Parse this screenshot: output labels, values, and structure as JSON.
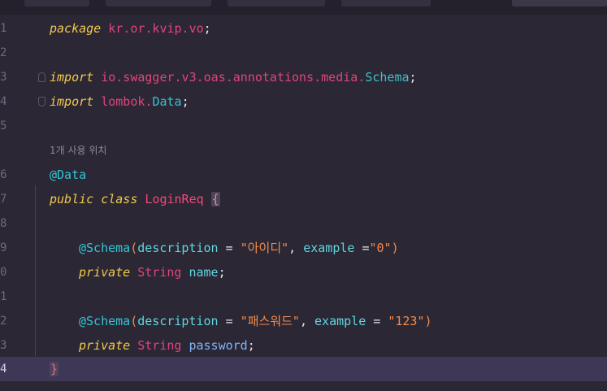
{
  "editor": {
    "line_numbers": [
      "1",
      "2",
      "3",
      "4",
      "5",
      "",
      "6",
      "7",
      "8",
      "9",
      "0",
      "1",
      "2",
      "3",
      "4"
    ],
    "inlay_hint": "1개 사용 위치",
    "tokens": {
      "l1_kw": "package",
      "l1_pkg": "kr.or.kvip.vo",
      "l1_end": ";",
      "l3_kw": "import",
      "l3_pkg": "io.swagger.v3.oas.annotations.media.",
      "l3_cls": "Schema",
      "l3_end": ";",
      "l4_kw": "import",
      "l4_pkg": "lombok.",
      "l4_cls": "Data",
      "l4_end": ";",
      "l6_ann": "@Data",
      "l7_kw": "public class",
      "l7_name": "LoginReq",
      "l7_brace": "{",
      "l9_ann": "@Schema",
      "l9_open": "(",
      "l9_attr1": "description",
      "l9_eq1": " = ",
      "l9_str1": "\"아이디\"",
      "l9_comma": ", ",
      "l9_attr2": "example",
      "l9_eq2": " =",
      "l9_str2": "\"0\"",
      "l9_close": ")",
      "l10_kw": "private",
      "l10_type": "String",
      "l10_var": "name",
      "l10_end": ";",
      "l12_ann": "@Schema",
      "l12_open": "(",
      "l12_attr1": "description",
      "l12_eq1": " = ",
      "l12_str1": "\"패스워드\"",
      "l12_comma": ", ",
      "l12_attr2": "example",
      "l12_eq2": " = ",
      "l12_str2": "\"123\"",
      "l12_close": ")",
      "l13_kw": "private",
      "l13_type": "String",
      "l13_var": "password",
      "l13_end": ";",
      "l14_brace": "}"
    }
  },
  "colors": {
    "background": "#2b2734",
    "keyword": "#f2c94c",
    "package": "#e0457b",
    "class": "#36c4cf",
    "string": "#f48b4b",
    "current_line": "#3e3756"
  }
}
